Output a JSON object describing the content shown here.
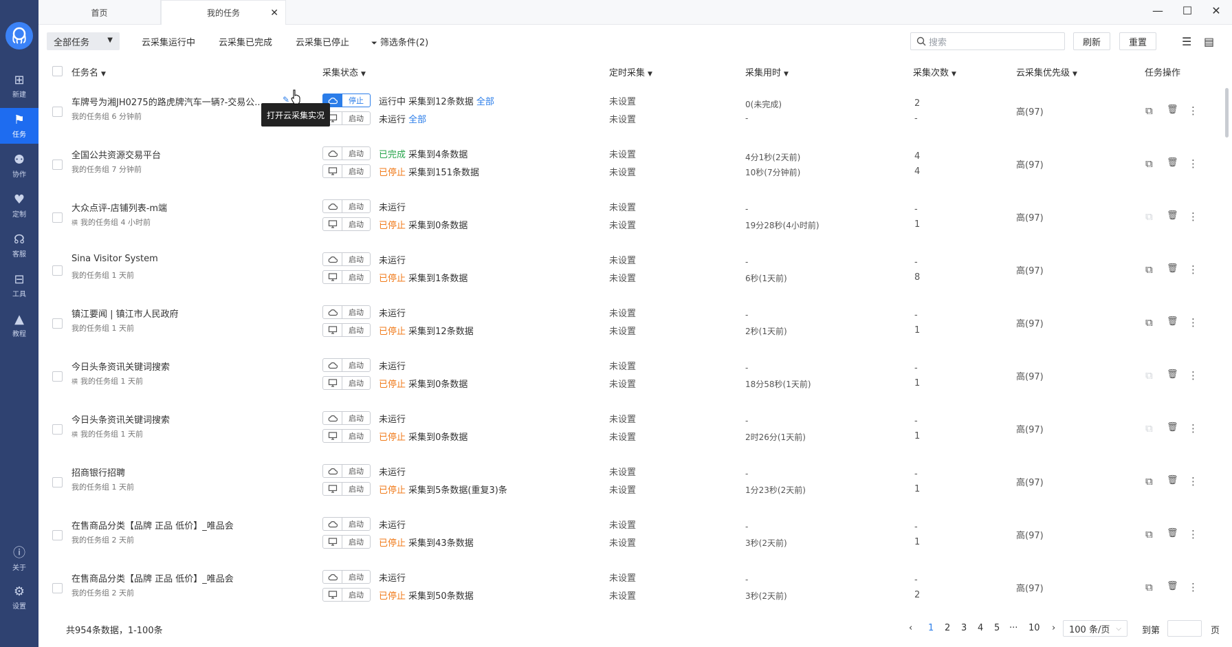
{
  "tabs": [
    {
      "label": "首页"
    },
    {
      "label": "我的任务"
    }
  ],
  "window": {
    "minimize": "—",
    "maximize": "☐",
    "close": "✕"
  },
  "sidebar": {
    "items": [
      {
        "label": "新建",
        "icon": "plus-square-icon",
        "glyph": "⊞"
      },
      {
        "label": "任务",
        "icon": "bookmark-icon",
        "glyph": "⚑"
      },
      {
        "label": "协作",
        "icon": "people-icon",
        "glyph": "⚉"
      },
      {
        "label": "定制",
        "icon": "heart-icon",
        "glyph": "♥"
      },
      {
        "label": "客服",
        "icon": "headset-icon",
        "glyph": "☊"
      },
      {
        "label": "工具",
        "icon": "toolbox-icon",
        "glyph": "⊟"
      },
      {
        "label": "教程",
        "icon": "graduation-cap-icon",
        "glyph": "▲"
      },
      {
        "label": "关于",
        "icon": "info-icon",
        "glyph": "ⓘ"
      },
      {
        "label": "设置",
        "icon": "gear-icon",
        "glyph": "⚙"
      }
    ]
  },
  "toolbar": {
    "all_tasks": "全部任务",
    "filters": [
      "云采集运行中",
      "云采集已完成",
      "云采集已停止",
      "筛选条件(2)"
    ],
    "search_placeholder": "搜索",
    "refresh": "刷新",
    "reset": "重置"
  },
  "columns": [
    "任务名",
    "采集状态",
    "定时采集",
    "采集用时",
    "采集次数",
    "云采集优先级",
    "任务操作"
  ],
  "tooltip": "打开云采集实况",
  "rows": [
    {
      "name": "车牌号为湘JH0275的路虎牌汽车一辆?-交易公...",
      "group": "我的任务组",
      "time": "6 分钟前",
      "tagged": false,
      "cloud_btn": "停止",
      "cloud_state": "运行中",
      "cloud_desc": "采集到12条数据",
      "cloud_link": "全部",
      "local_btn": "启动",
      "local_state": "未运行",
      "local_desc": "",
      "local_link": "全部",
      "sched1": "未设置",
      "sched2": "未设置",
      "dur1": "0(未完成)",
      "dur2": "-",
      "cnt1": "2",
      "cnt2": "-",
      "priority": "高(97)",
      "copy_enabled": true
    },
    {
      "name": "全国公共资源交易平台",
      "group": "我的任务组",
      "time": "7 分钟前",
      "tagged": false,
      "cloud_btn": "启动",
      "cloud_state": "已完成",
      "cloud_desc": "采集到4条数据",
      "cloud_link": "",
      "local_btn": "启动",
      "local_state": "已停止",
      "local_desc": "采集到151条数据",
      "local_link": "",
      "sched1": "未设置",
      "sched2": "未设置",
      "dur1": "4分1秒(2天前)",
      "dur2": "10秒(7分钟前)",
      "cnt1": "4",
      "cnt2": "4",
      "priority": "高(97)",
      "copy_enabled": true
    },
    {
      "name": "大众点评-店铺列表-m端",
      "group": "我的任务组",
      "time": "4 小时前",
      "tagged": true,
      "cloud_btn": "启动",
      "cloud_state": "未运行",
      "cloud_desc": "",
      "cloud_link": "",
      "local_btn": "启动",
      "local_state": "已停止",
      "local_desc": "采集到0条数据",
      "local_link": "",
      "sched1": "未设置",
      "sched2": "未设置",
      "dur1": "-",
      "dur2": "19分28秒(4小时前)",
      "cnt1": "-",
      "cnt2": "1",
      "priority": "高(97)",
      "copy_enabled": false
    },
    {
      "name": "Sina Visitor System",
      "group": "我的任务组",
      "time": "1 天前",
      "tagged": false,
      "cloud_btn": "启动",
      "cloud_state": "未运行",
      "cloud_desc": "",
      "cloud_link": "",
      "local_btn": "启动",
      "local_state": "已停止",
      "local_desc": "采集到1条数据",
      "local_link": "",
      "sched1": "未设置",
      "sched2": "未设置",
      "dur1": "-",
      "dur2": "6秒(1天前)",
      "cnt1": "-",
      "cnt2": "8",
      "priority": "高(97)",
      "copy_enabled": true
    },
    {
      "name": "镇江要闻 | 镇江市人民政府",
      "group": "我的任务组",
      "time": "1 天前",
      "tagged": false,
      "cloud_btn": "启动",
      "cloud_state": "未运行",
      "cloud_desc": "",
      "cloud_link": "",
      "local_btn": "启动",
      "local_state": "已停止",
      "local_desc": "采集到12条数据",
      "local_link": "",
      "sched1": "未设置",
      "sched2": "未设置",
      "dur1": "-",
      "dur2": "2秒(1天前)",
      "cnt1": "-",
      "cnt2": "1",
      "priority": "高(97)",
      "copy_enabled": true
    },
    {
      "name": "今日头条资讯关键词搜索",
      "group": "我的任务组",
      "time": "1 天前",
      "tagged": true,
      "cloud_btn": "启动",
      "cloud_state": "未运行",
      "cloud_desc": "",
      "cloud_link": "",
      "local_btn": "启动",
      "local_state": "已停止",
      "local_desc": "采集到0条数据",
      "local_link": "",
      "sched1": "未设置",
      "sched2": "未设置",
      "dur1": "-",
      "dur2": "18分58秒(1天前)",
      "cnt1": "-",
      "cnt2": "1",
      "priority": "高(97)",
      "copy_enabled": false
    },
    {
      "name": "今日头条资讯关键词搜索",
      "group": "我的任务组",
      "time": "1 天前",
      "tagged": true,
      "cloud_btn": "启动",
      "cloud_state": "未运行",
      "cloud_desc": "",
      "cloud_link": "",
      "local_btn": "启动",
      "local_state": "已停止",
      "local_desc": "采集到0条数据",
      "local_link": "",
      "sched1": "未设置",
      "sched2": "未设置",
      "dur1": "-",
      "dur2": "2时26分(1天前)",
      "cnt1": "-",
      "cnt2": "1",
      "priority": "高(97)",
      "copy_enabled": false
    },
    {
      "name": "招商银行招聘",
      "group": "我的任务组",
      "time": "1 天前",
      "tagged": false,
      "cloud_btn": "启动",
      "cloud_state": "未运行",
      "cloud_desc": "",
      "cloud_link": "",
      "local_btn": "启动",
      "local_state": "已停止",
      "local_desc": "采集到5条数据(重复3)条",
      "local_link": "",
      "sched1": "未设置",
      "sched2": "未设置",
      "dur1": "-",
      "dur2": "1分23秒(2天前)",
      "cnt1": "-",
      "cnt2": "1",
      "priority": "高(97)",
      "copy_enabled": true
    },
    {
      "name": "在售商品分类【品牌 正品 低价】_唯品会",
      "group": "我的任务组",
      "time": "2 天前",
      "tagged": false,
      "cloud_btn": "启动",
      "cloud_state": "未运行",
      "cloud_desc": "",
      "cloud_link": "",
      "local_btn": "启动",
      "local_state": "已停止",
      "local_desc": "采集到43条数据",
      "local_link": "",
      "sched1": "未设置",
      "sched2": "未设置",
      "dur1": "-",
      "dur2": "3秒(2天前)",
      "cnt1": "-",
      "cnt2": "1",
      "priority": "高(97)",
      "copy_enabled": true
    },
    {
      "name": "在售商品分类【品牌 正品 低价】_唯品会",
      "group": "我的任务组",
      "time": "2 天前",
      "tagged": false,
      "cloud_btn": "启动",
      "cloud_state": "未运行",
      "cloud_desc": "",
      "cloud_link": "",
      "local_btn": "启动",
      "local_state": "已停止",
      "local_desc": "采集到50条数据",
      "local_link": "",
      "sched1": "未设置",
      "sched2": "未设置",
      "dur1": "-",
      "dur2": "3秒(2天前)",
      "cnt1": "-",
      "cnt2": "2",
      "priority": "高(97)",
      "copy_enabled": true
    }
  ],
  "footer": {
    "summary": "共954条数据，1-100条",
    "pages": [
      "1",
      "2",
      "3",
      "4",
      "5",
      "···",
      "10"
    ],
    "current_page": "1",
    "page_size": "100 条/页",
    "goto_label": "到第",
    "goto_suffix": "页",
    "prev": "‹",
    "next": "›"
  }
}
